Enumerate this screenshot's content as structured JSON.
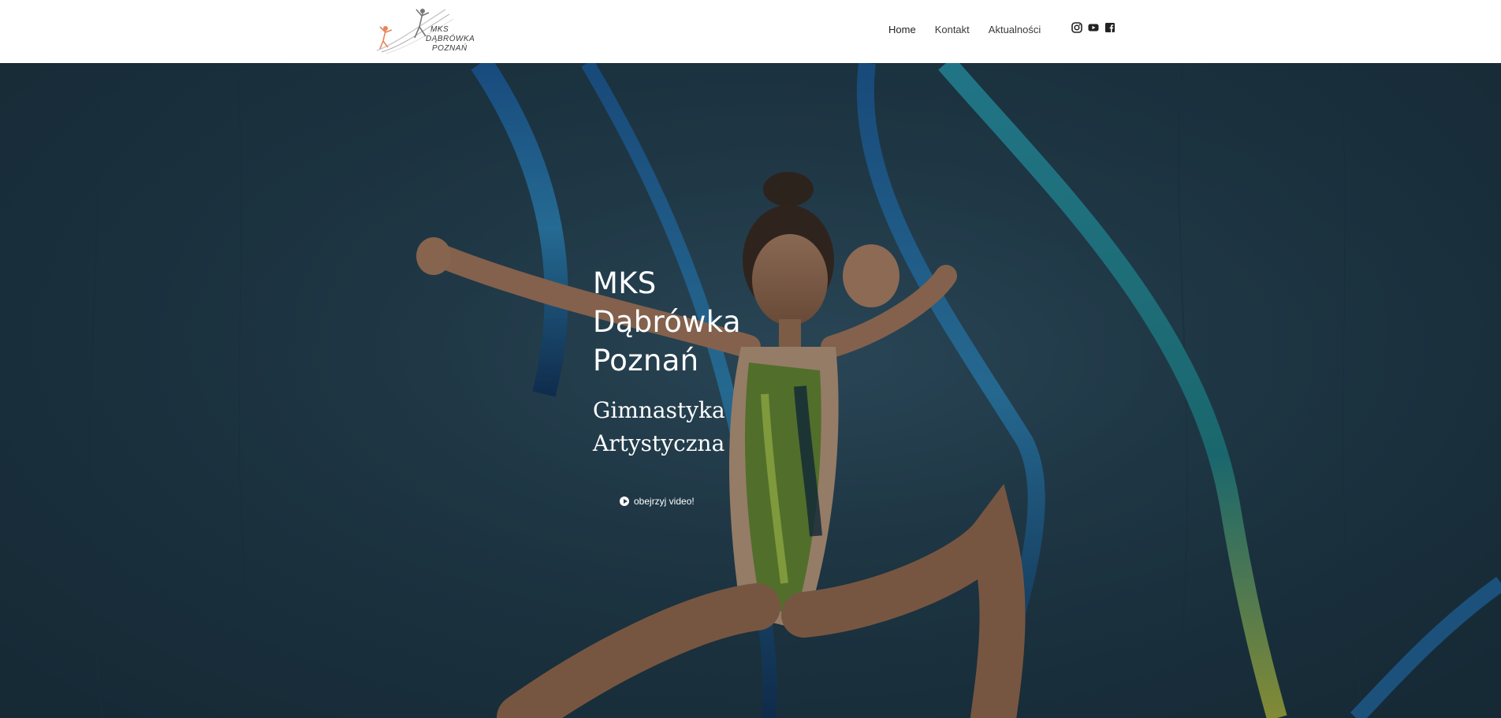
{
  "header": {
    "logo_lines": [
      "MKS",
      "DĄBRÓWKA",
      "POZNAŃ"
    ],
    "nav": [
      {
        "label": "Home"
      },
      {
        "label": "Kontakt"
      },
      {
        "label": "Aktualności"
      }
    ],
    "social": [
      {
        "icon": "instagram-icon"
      },
      {
        "icon": "youtube-icon"
      },
      {
        "icon": "facebook-icon"
      }
    ]
  },
  "hero": {
    "title_lines": [
      "MKS",
      "Dąbrówka",
      "Poznań"
    ],
    "subtitle_lines": [
      "Gimnastyka",
      "Artystyczna"
    ],
    "video_button": "obejrzyj video!"
  },
  "colors": {
    "hero_bg": "#213a4a",
    "text_light": "#ffffff",
    "nav_text": "#3b3b3b"
  }
}
